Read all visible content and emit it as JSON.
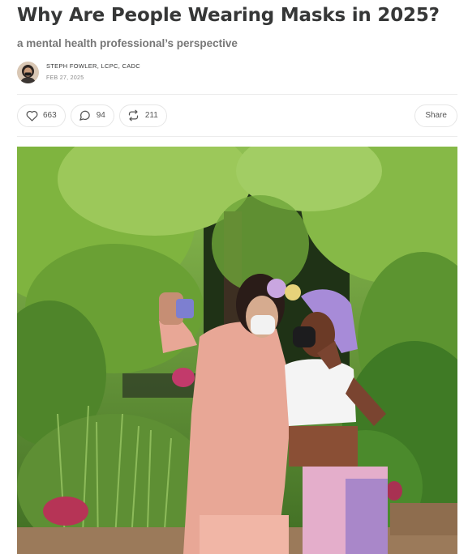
{
  "post": {
    "title": "Why Are People Wearing Masks in 2025?",
    "subtitle": "a mental health professional’s perspective",
    "author": "STEPH FOWLER, LCPC, CADC",
    "date": "FEB 27, 2025"
  },
  "actions": {
    "likes": "663",
    "comments": "94",
    "restacks": "211",
    "share_label": "Share"
  },
  "icons": {
    "like": "heart-icon",
    "comment": "comment-bubble-icon",
    "restack": "restack-arrows-icon"
  },
  "colors": {
    "text": "#363737",
    "muted": "#777777",
    "border": "#e6e6e6"
  }
}
